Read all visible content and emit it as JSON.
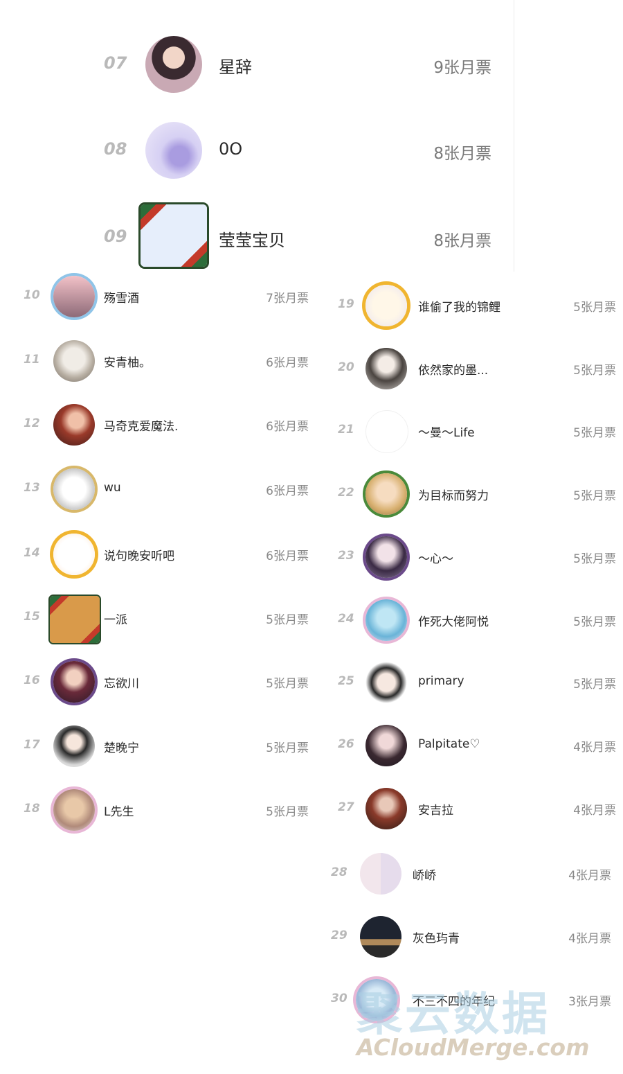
{
  "colors": {
    "rank": "#b9b9b9",
    "name": "#2a2a2a",
    "votes": "#8a8a8a",
    "divider": "#ececec"
  },
  "top_entries": [
    {
      "rank": "07",
      "name": "星辞",
      "votes": "9张月票",
      "avatar_icon": "user-avatar-icon",
      "avatar_color": "#7a5a6a"
    },
    {
      "rank": "08",
      "name": "0O",
      "votes": "8张月票",
      "avatar_icon": "user-avatar-icon",
      "avatar_color": "#c9c1ec"
    },
    {
      "rank": "09",
      "name": "莹莹宝贝",
      "votes": "8张月票",
      "avatar_icon": "user-avatar-icon",
      "avatar_color": "#8aa8d8"
    }
  ],
  "left_entries": [
    {
      "rank": "10",
      "name": "殇雪酒",
      "votes": "7张月票"
    },
    {
      "rank": "11",
      "name": "安青柚。",
      "votes": "6张月票"
    },
    {
      "rank": "12",
      "name": "马奇克爱魔法.",
      "votes": "6张月票"
    },
    {
      "rank": "13",
      "name": "wu",
      "votes": "6张月票"
    },
    {
      "rank": "14",
      "name": "说句晚安听吧",
      "votes": "6张月票"
    },
    {
      "rank": "15",
      "name": "一派",
      "votes": "5张月票"
    },
    {
      "rank": "16",
      "name": "忘欲川",
      "votes": "5张月票"
    },
    {
      "rank": "17",
      "name": "楚晚宁",
      "votes": "5张月票"
    },
    {
      "rank": "18",
      "name": "L先生",
      "votes": "5张月票"
    }
  ],
  "right_entries": [
    {
      "rank": "19",
      "name": "谁偷了我的锦鲤",
      "votes": "5张月票"
    },
    {
      "rank": "20",
      "name": "依然家的墨...",
      "votes": "5张月票"
    },
    {
      "rank": "21",
      "name": "～曼～Life",
      "votes": "5张月票"
    },
    {
      "rank": "22",
      "name": "为目标而努力",
      "votes": "5张月票"
    },
    {
      "rank": "23",
      "name": "～心～",
      "votes": "5张月票"
    },
    {
      "rank": "24",
      "name": "作死大佬阿悦",
      "votes": "5张月票"
    },
    {
      "rank": "25",
      "name": "primary",
      "votes": "5张月票"
    },
    {
      "rank": "26",
      "name": "Palpitate♡",
      "votes": "4张月票"
    },
    {
      "rank": "27",
      "name": "安吉拉",
      "votes": "4张月票"
    },
    {
      "rank": "28",
      "name": "峤峤",
      "votes": "4张月票"
    },
    {
      "rank": "29",
      "name": "灰色玙青",
      "votes": "4张月票"
    },
    {
      "rank": "30",
      "name": "不三不四的年纪",
      "votes": "3张月票"
    }
  ],
  "watermark": {
    "title": "聚云数据",
    "url": "ACloudMerge.com"
  }
}
